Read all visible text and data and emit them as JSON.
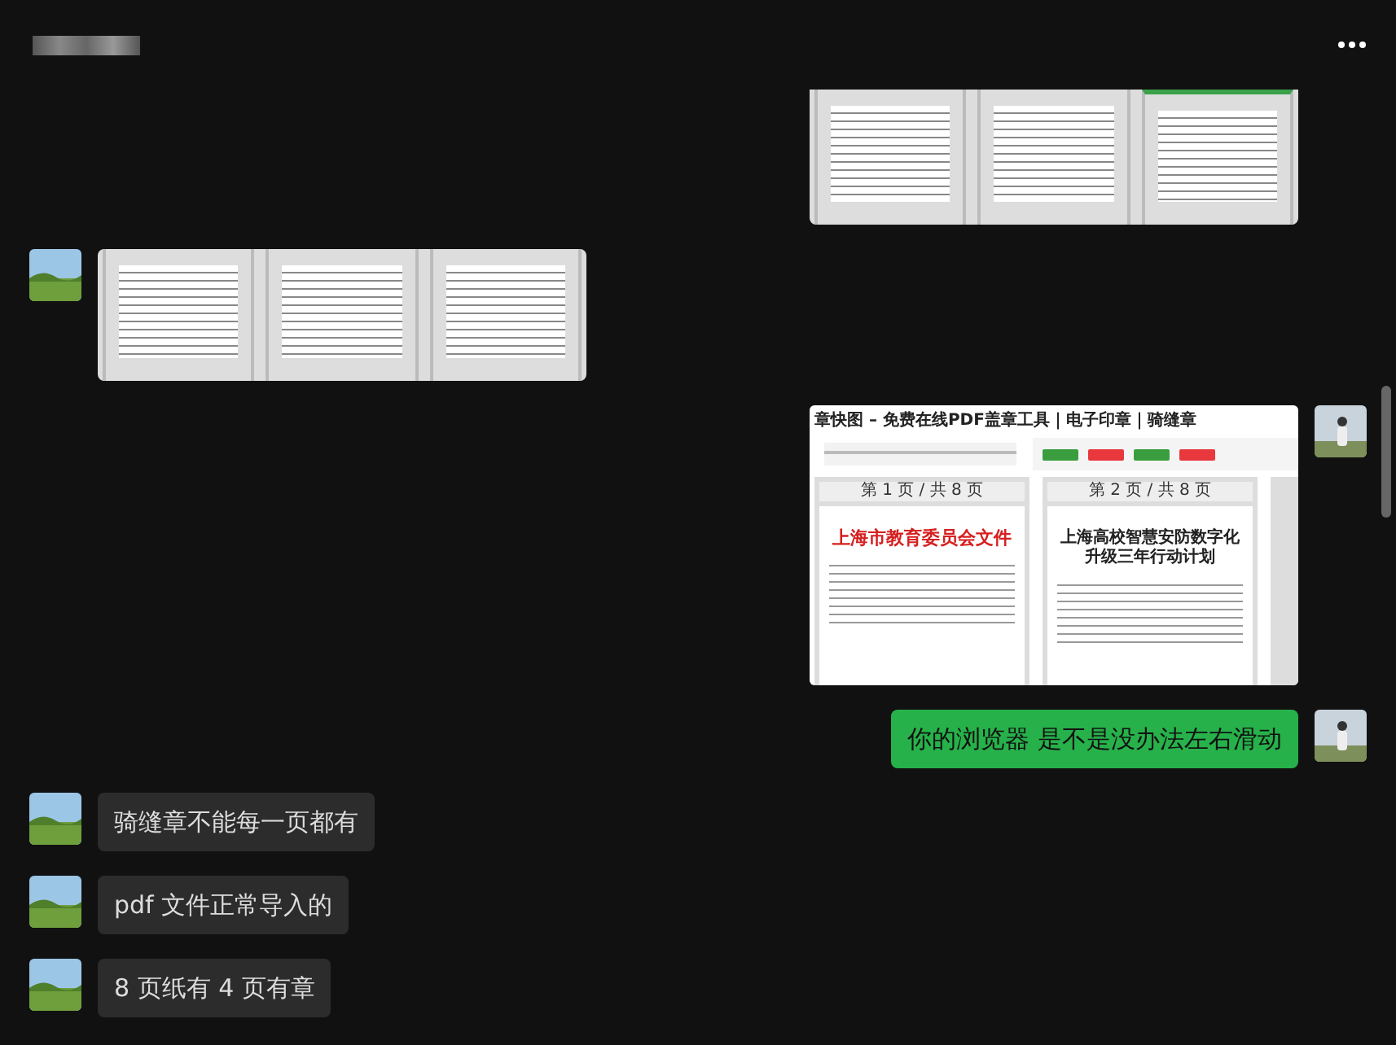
{
  "messages": [
    {
      "outgoing": true,
      "kind": "document_pages",
      "cropped": true
    },
    {
      "outgoing": false,
      "kind": "document_pages"
    },
    {
      "outgoing": true,
      "kind": "web_screenshot",
      "screenshot": {
        "title": "章快图 – 免费在线PDF盖章工具｜电子印章｜骑缝章",
        "buttons": [
          {
            "color": "#3a9e3f"
          },
          {
            "color": "#e8383d"
          },
          {
            "color": "#3a9e3f"
          },
          {
            "color": "#e8383d"
          }
        ],
        "pages": [
          {
            "label": "第 1 页 / 共 8 页",
            "heading": "上海市教育委员会文件"
          },
          {
            "label": "第 2 页 / 共 8 页",
            "heading": "上海高校智慧安防数字化升级三年行动计划"
          }
        ]
      }
    },
    {
      "outgoing": true,
      "kind": "text",
      "text": "你的浏览器 是不是没办法左右滑动"
    },
    {
      "outgoing": false,
      "kind": "text",
      "text": "骑缝章不能每一页都有"
    },
    {
      "outgoing": false,
      "kind": "text",
      "text": "pdf 文件正常导入的"
    },
    {
      "outgoing": false,
      "kind": "text",
      "text": "8 页纸有 4 页有章"
    }
  ]
}
